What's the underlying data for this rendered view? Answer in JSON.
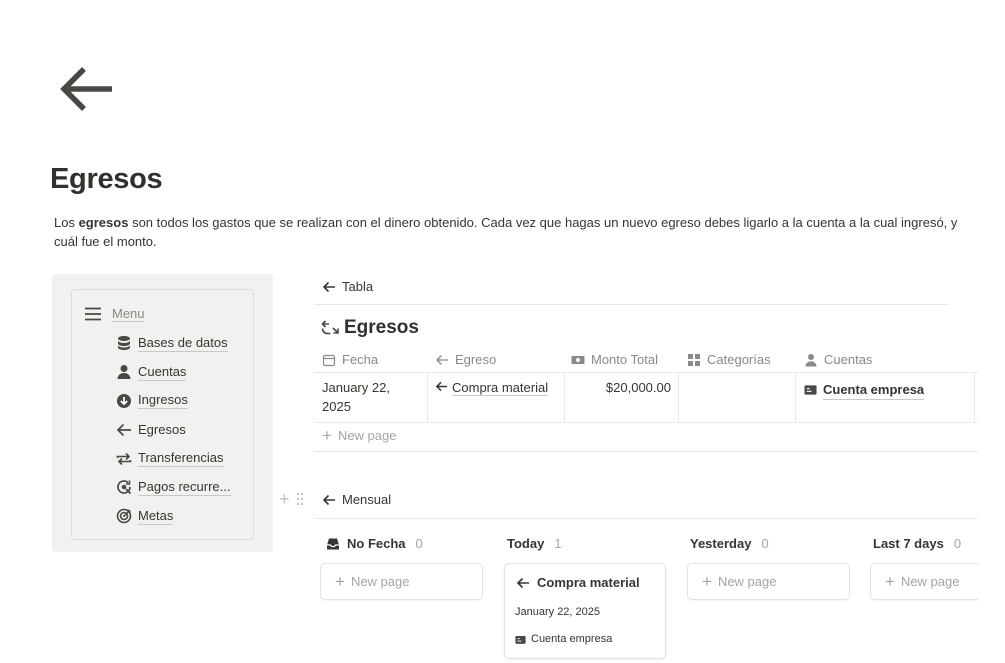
{
  "page": {
    "icon": "arrow-left-icon",
    "title": "Egresos",
    "description": {
      "prefix": "Los ",
      "bold": "egresos",
      "suffix": " son todos los gastos que se realizan con el dinero obtenido. Cada vez que hagas un nuevo egreso debes ligarlo a la cuenta a la cual ingresó, y cuál fue el monto."
    }
  },
  "menu": {
    "title": "Menu",
    "items": [
      {
        "label": "Bases de datos",
        "icon": "database-icon"
      },
      {
        "label": "Cuentas",
        "icon": "person-icon"
      },
      {
        "label": "Ingresos",
        "icon": "arrow-down-circle-icon"
      },
      {
        "label": "Egresos",
        "icon": "arrow-left-icon"
      },
      {
        "label": "Transferencias",
        "icon": "repeat-icon"
      },
      {
        "label": "Pagos recurre...",
        "icon": "recurring-icon"
      },
      {
        "label": "Metas",
        "icon": "target-icon"
      }
    ]
  },
  "table_view": {
    "tab_label": "Tabla",
    "database_title": "Egresos",
    "columns": [
      {
        "label": "Fecha",
        "icon": "calendar-icon"
      },
      {
        "label": "Egreso",
        "icon": "arrow-left-icon"
      },
      {
        "label": "Monto Total",
        "icon": "money-icon"
      },
      {
        "label": "Categorías",
        "icon": "grid-icon"
      },
      {
        "label": "Cuentas",
        "icon": "person-icon"
      }
    ],
    "rows": [
      {
        "fecha": "January 22, 2025",
        "egreso": "Compra material",
        "monto": "$20,000.00",
        "categorias": "",
        "cuentas": "Cuenta empresa"
      }
    ],
    "new_page_label": "New page"
  },
  "board_view": {
    "tab_label": "Mensual",
    "groups": [
      {
        "name": "No Fecha",
        "count": "0",
        "icon": "inbox-icon"
      },
      {
        "name": "Today",
        "count": "1"
      },
      {
        "name": "Yesterday",
        "count": "0"
      },
      {
        "name": "Last 7 days",
        "count": "0"
      }
    ],
    "new_page_label": "New page",
    "card": {
      "title": "Compra material",
      "date": "January 22, 2025",
      "account": "Cuenta empresa"
    }
  }
}
